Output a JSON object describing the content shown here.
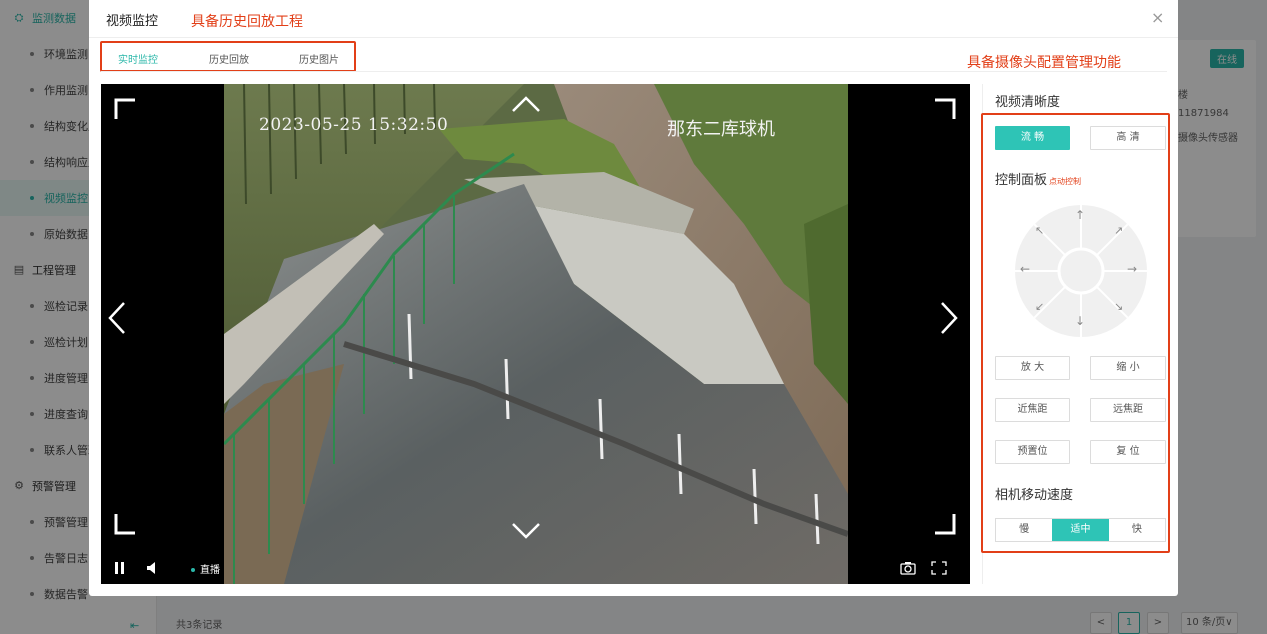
{
  "sidebar": {
    "groups": [
      {
        "icon": "monitor-data-icon",
        "label": "监测数据",
        "items": [
          "环境监测",
          "作用监测",
          "结构变化监测",
          "结构响应监测",
          "视频监控",
          "原始数据"
        ]
      },
      {
        "icon": "project-icon",
        "label": "工程管理",
        "items": [
          "巡检记录",
          "巡检计划",
          "进度管理",
          "进度查询",
          "联系人管理"
        ]
      },
      {
        "icon": "alarm-icon",
        "label": "预警管理",
        "items": [
          "预警管理",
          "告警日志",
          "数据告警"
        ]
      }
    ],
    "active_item": "视频监控",
    "collapse_icon": "collapse-icon"
  },
  "background": {
    "status_badge": "在线",
    "info_lines": [
      "楼",
      "11871984",
      "摄像头传感器"
    ],
    "total_records": "共3条记录",
    "pager": {
      "prev": "<",
      "current": "1",
      "next": ">",
      "page_size": "10 条/页∨"
    }
  },
  "modal": {
    "title": "视频监控",
    "annotation_top": "具备历史回放工程",
    "annotation_right": "具备摄像头配置管理功能",
    "close": "×",
    "tabs": [
      {
        "label": "实时监控",
        "active": true
      },
      {
        "label": "历史回放",
        "active": false
      },
      {
        "label": "历史图片",
        "active": false
      }
    ]
  },
  "video": {
    "timestamp": "2023-05-25 15:32:50",
    "camera_name": "那东二库球机",
    "live_label": "直播",
    "icons": [
      "corner-bracket-icon",
      "chevron-up-icon",
      "chevron-down-icon",
      "chevron-left-icon",
      "chevron-right-icon",
      "pause-icon",
      "volume-icon",
      "snapshot-icon",
      "fullscreen-icon"
    ]
  },
  "panel": {
    "clarity_title": "视频清晰度",
    "clarity_options": [
      {
        "label": "流 畅",
        "selected": true
      },
      {
        "label": "高 清",
        "selected": false
      }
    ],
    "control_title": "控制面板",
    "control_sub": "点动控制",
    "dpad_arrows": {
      "up": "↑",
      "down": "↓",
      "left": "←",
      "right": "→",
      "up_left": "↖",
      "up_right": "↗",
      "down_left": "↙",
      "down_right": "↘"
    },
    "buttons": [
      {
        "label": "放 大"
      },
      {
        "label": "缩 小"
      },
      {
        "label": "近焦距"
      },
      {
        "label": "远焦距"
      },
      {
        "label": "预置位"
      },
      {
        "label": "复 位"
      }
    ],
    "speed_title": "相机移动速度",
    "speed_options": [
      {
        "label": "慢",
        "selected": false
      },
      {
        "label": "适中",
        "selected": true
      },
      {
        "label": "快",
        "selected": false
      }
    ]
  },
  "colors": {
    "accent": "#2ec4b6",
    "annotation": "#e23f18"
  }
}
